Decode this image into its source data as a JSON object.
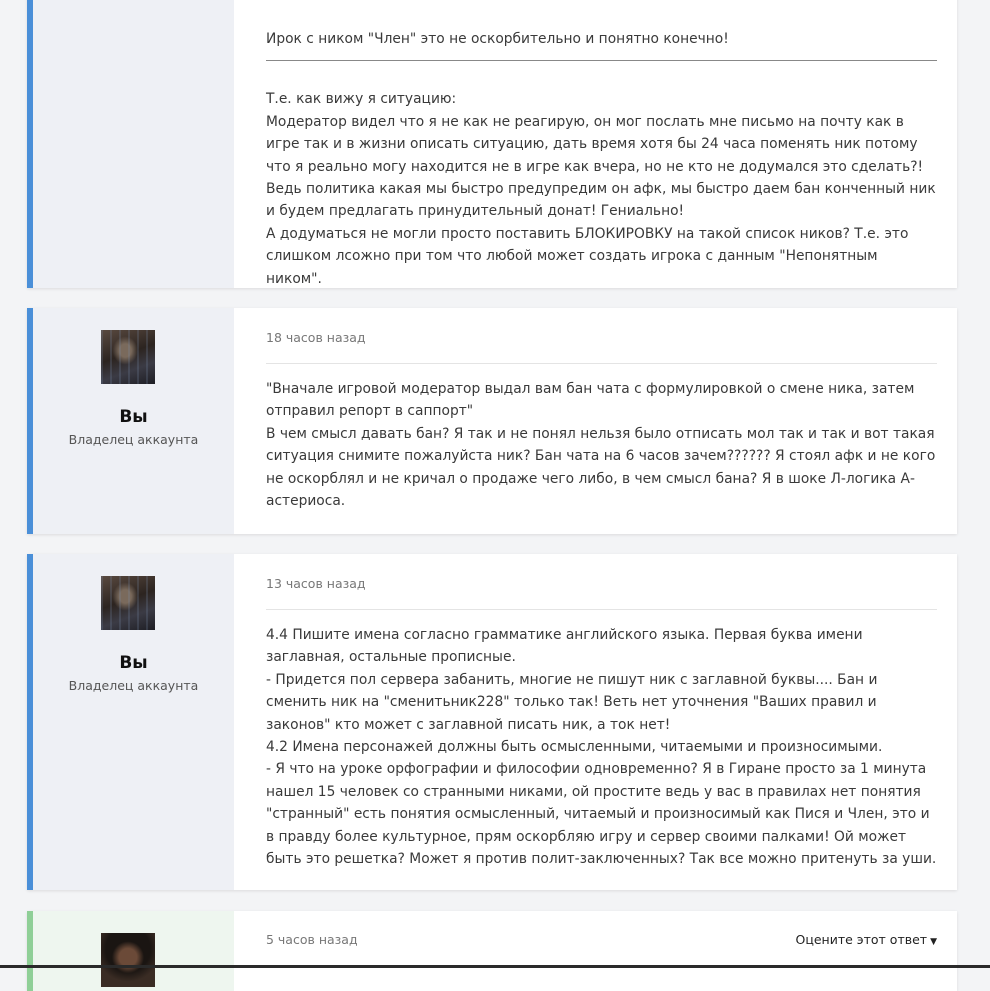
{
  "posts": [
    {
      "quote": "Ирок с ником \"Член\" это не оскорбительно и понятно конечно!",
      "text": "Т.е. как вижу я ситуацию:\nМодератор видел что я не как не реагирую, он мог послать мне письмо на почту как в игре так и в жизни описать ситуацию, дать время хотя бы 24 часа поменять ник потому что я реально могу находится не в игре как вчера, но не кто не додумался это сделать?! Ведь политика какая мы быстро предупредим он афк, мы быстро даем бан конченный ник и будем предлагать принудительный донат! Гениально!\nА додуматься не могли просто поставить БЛОКИРОВКУ на такой список ников? Т.е. это слишком лсожно при том что любой может создать игрока с данным \"Непонятным ником\"."
    },
    {
      "author": "Вы",
      "role": "Владелец аккаунта",
      "time": "18 часов назад",
      "text": "\"Вначале игровой модератор выдал вам бан чата с формулировкой о смене ника, затем отправил репорт в саппорт\"\nВ чем смысл давать бан? Я так и не понял нельзя было отписать мол так и так и вот такая ситуация снимите пожалуйста ник? Бан чата на 6 часов зачем?????? Я стоял афк и не кого не оскорблял и не кричал о продаже чего либо, в чем смысл бана? Я в шоке Л-логика А-астериоса."
    },
    {
      "author": "Вы",
      "role": "Владелец аккаунта",
      "time": "13 часов назад",
      "text": "4.4 Пишите имена согласно грамматике английского языка. Первая буква имени заглавная, остальные прописные.\n- Придется пол сервера забанить, многие не пишут ник с заглавной буквы.... Бан и сменить ник на \"сменитьник228\" только так! Веть нет уточнения \"Ваших правил и законов\" кто может с заглавной писать ник, а ток нет!\n4.2 Имена персонажей должны быть осмысленными, читаемыми и произносимыми.\n- Я что на уроке орфографии и философии одновременно? Я в Гиране просто за 1 минута нашел 15 человек со странными никами, ой простите ведь у вас в правилах нет понятия \"странный\" есть понятия осмысленный, читаемый и произносимый как Пися и Член, это и в правду более культурное, прям оскорбляю игру и сервер своими палками! Ой может быть это решетка? Может я против полит-заключенных? Так все можно притенуть за уши."
    },
    {
      "time": "5 часов назад",
      "rate_label": "Оцените этот ответ"
    }
  ],
  "colors": {
    "accent": "#4a8fd8",
    "staff_accent": "#8fcf97"
  }
}
